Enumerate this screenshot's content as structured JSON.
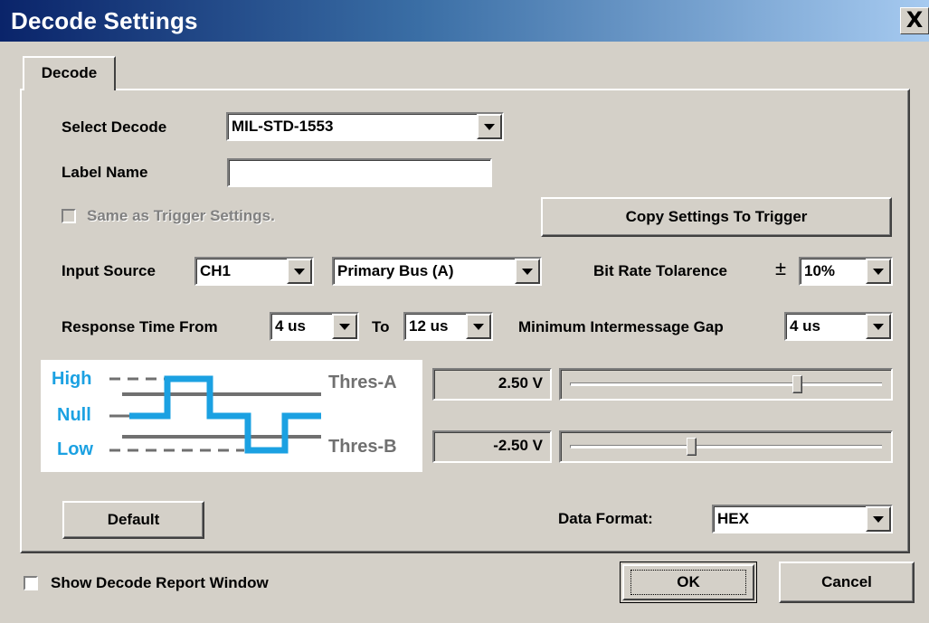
{
  "window": {
    "title": "Decode Settings",
    "close_glyph": "X"
  },
  "tabs": [
    {
      "label": "Decode"
    }
  ],
  "form": {
    "select_decode": {
      "label": "Select Decode",
      "value": "MIL-STD-1553"
    },
    "label_name": {
      "label": "Label Name",
      "value": ""
    },
    "same_as_trigger": {
      "label": "Same as Trigger Settings.",
      "checked": false,
      "enabled": false
    },
    "copy_settings_button": "Copy Settings To Trigger",
    "input_source": {
      "label": "Input Source",
      "channel": "CH1",
      "bus": "Primary Bus (A)"
    },
    "bit_rate_tolerance": {
      "label": "Bit Rate Tolarence",
      "symbol": "±",
      "value": "10%"
    },
    "response_time": {
      "label_from": "Response Time From",
      "from_value": "4 us",
      "label_to": "To",
      "to_value": "12 us"
    },
    "min_gap": {
      "label": "Minimum Intermessage Gap",
      "value": "4 us"
    },
    "thresholds": {
      "a": {
        "label": "Thres-A",
        "value": "2.50 V",
        "level": 0.73
      },
      "b": {
        "label": "Thres-B",
        "value": "-2.50 V",
        "level": 0.39
      }
    },
    "diagram_levels": {
      "high": "High",
      "null": "Null",
      "low": "Low"
    },
    "default_button": "Default",
    "data_format": {
      "label": "Data Format:",
      "value": "HEX"
    }
  },
  "footer": {
    "show_report": {
      "label": "Show Decode Report Window",
      "checked": false
    },
    "ok_button": "OK",
    "cancel_button": "Cancel"
  },
  "colors": {
    "title_start": "#0a246a",
    "title_end": "#a6caf0",
    "signal_blue": "#1ba1e2",
    "threshold_gray": "#707070",
    "face": "#d4d0c8"
  }
}
